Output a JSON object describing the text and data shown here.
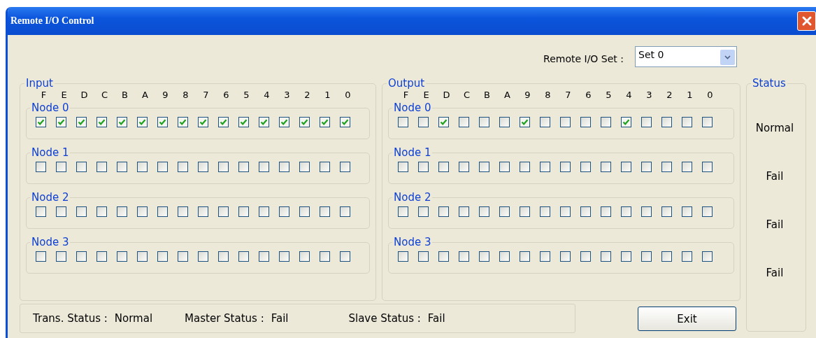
{
  "window": {
    "title": "Remote I/O Control"
  },
  "io_set": {
    "label": "Remote I/O Set :",
    "value": "Set 0"
  },
  "groups": [
    {
      "title": "Input",
      "bit_labels": [
        "F",
        "E",
        "D",
        "C",
        "B",
        "A",
        "9",
        "8",
        "7",
        "6",
        "5",
        "4",
        "3",
        "2",
        "1",
        "0"
      ],
      "nodes": [
        {
          "name": "Node 0",
          "bits": [
            true,
            true,
            true,
            true,
            true,
            true,
            true,
            true,
            true,
            true,
            true,
            true,
            true,
            true,
            true,
            true
          ]
        },
        {
          "name": "Node 1",
          "bits": [
            false,
            false,
            false,
            false,
            false,
            false,
            false,
            false,
            false,
            false,
            false,
            false,
            false,
            false,
            false,
            false
          ]
        },
        {
          "name": "Node 2",
          "bits": [
            false,
            false,
            false,
            false,
            false,
            false,
            false,
            false,
            false,
            false,
            false,
            false,
            false,
            false,
            false,
            false
          ]
        },
        {
          "name": "Node 3",
          "bits": [
            false,
            false,
            false,
            false,
            false,
            false,
            false,
            false,
            false,
            false,
            false,
            false,
            false,
            false,
            false,
            false
          ]
        }
      ]
    },
    {
      "title": "Output",
      "bit_labels": [
        "F",
        "E",
        "D",
        "C",
        "B",
        "A",
        "9",
        "8",
        "7",
        "6",
        "5",
        "4",
        "3",
        "2",
        "1",
        "0"
      ],
      "nodes": [
        {
          "name": "Node 0",
          "bits": [
            false,
            false,
            true,
            false,
            false,
            false,
            true,
            false,
            false,
            false,
            false,
            true,
            false,
            false,
            false,
            false
          ]
        },
        {
          "name": "Node 1",
          "bits": [
            false,
            false,
            false,
            false,
            false,
            false,
            false,
            false,
            false,
            false,
            false,
            false,
            false,
            false,
            false,
            false
          ]
        },
        {
          "name": "Node 2",
          "bits": [
            false,
            false,
            false,
            false,
            false,
            false,
            false,
            false,
            false,
            false,
            false,
            false,
            false,
            false,
            false,
            false
          ]
        },
        {
          "name": "Node 3",
          "bits": [
            false,
            false,
            false,
            false,
            false,
            false,
            false,
            false,
            false,
            false,
            false,
            false,
            false,
            false,
            false,
            false
          ]
        }
      ]
    }
  ],
  "status": {
    "title": "Status",
    "values": [
      "Normal",
      "Fail",
      "Fail",
      "Fail"
    ]
  },
  "status_bar": [
    {
      "label": "Trans. Status :",
      "value": "Normal"
    },
    {
      "label": "Master Status :",
      "value": "Fail"
    },
    {
      "label": "Slave Status :",
      "value": "Fail"
    }
  ],
  "buttons": [
    {
      "label": "Exit"
    }
  ]
}
